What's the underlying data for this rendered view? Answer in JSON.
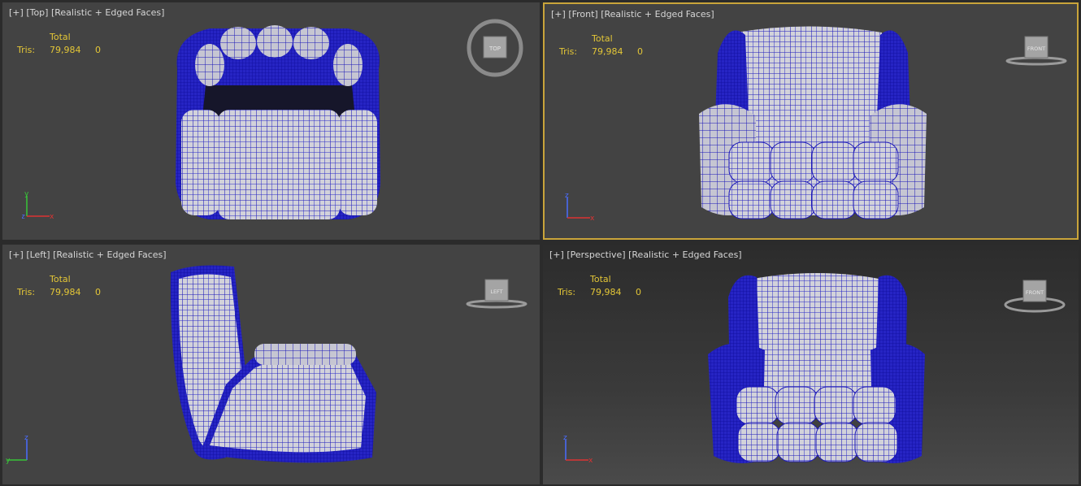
{
  "viewports": [
    {
      "id": "top",
      "label_plus": "[+]",
      "label_view": "[Top]",
      "label_shading": "[Realistic + Edged Faces]",
      "stats": {
        "header": "Total",
        "tris_label": "Tris:",
        "tris_total": "79,984",
        "tris_sel": "0"
      },
      "viewcube_text": "TOP",
      "axes": [
        "y",
        "z",
        "x"
      ],
      "active": false
    },
    {
      "id": "front",
      "label_plus": "[+]",
      "label_view": "[Front]",
      "label_shading": "[Realistic + Edged Faces]",
      "stats": {
        "header": "Total",
        "tris_label": "Tris:",
        "tris_total": "79,984",
        "tris_sel": "0"
      },
      "viewcube_text": "FRONT",
      "axes": [
        "z",
        "x"
      ],
      "active": true
    },
    {
      "id": "left",
      "label_plus": "[+]",
      "label_view": "[Left]",
      "label_shading": "[Realistic + Edged Faces]",
      "stats": {
        "header": "Total",
        "tris_label": "Tris:",
        "tris_total": "79,984",
        "tris_sel": "0"
      },
      "viewcube_text": "LEFT",
      "axes": [
        "z",
        "y"
      ],
      "active": false
    },
    {
      "id": "perspective",
      "label_plus": "[+]",
      "label_view": "[Perspective]",
      "label_shading": "[Realistic + Edged Faces]",
      "stats": {
        "header": "Total",
        "tris_label": "Tris:",
        "tris_total": "79,984",
        "tris_sel": "0"
      },
      "viewcube_text": "FRONT",
      "axes": [
        "z",
        "x"
      ],
      "active": false
    }
  ],
  "colors": {
    "wire": "#1a16b8",
    "fabric": "#cfcfd6",
    "active_border": "#c9a43a",
    "stats_text": "#e3c637"
  },
  "icons": [
    "viewcube-icon",
    "axis-tripod-icon",
    "armchair-mesh"
  ]
}
